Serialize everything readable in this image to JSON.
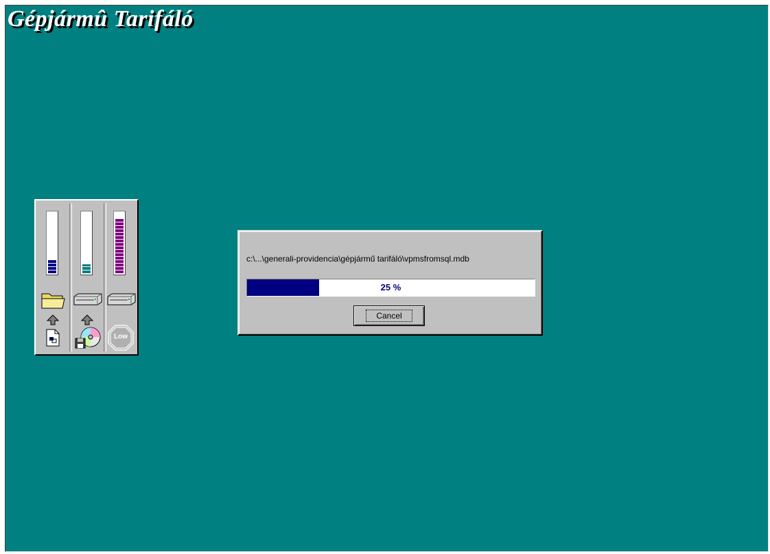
{
  "app": {
    "title": "Gépjármû Tarifáló"
  },
  "monitor": {
    "meters": [
      {
        "name": "disk-space-meter",
        "level": 0.22,
        "color": "#000080"
      },
      {
        "name": "source-space-meter",
        "level": 0.15,
        "color": "#008080"
      },
      {
        "name": "memory-meter",
        "level": 0.9,
        "color": "#800080"
      }
    ],
    "low_label": "Low",
    "icons": [
      "folder-icon",
      "hard-drive-icon",
      "hard-drive-icon",
      "arrow-up-icon",
      "arrow-up-icon",
      "document-icon",
      "cd-disk-icon",
      "low-stop-icon"
    ]
  },
  "dialog": {
    "file_path": "c:\\...\\generali-providencia\\gépjármű tarifáló\\vpmsfromsql.mdb",
    "progress_percent": 25,
    "progress_text": "25 %",
    "cancel_label": "Cancel"
  },
  "colors": {
    "desktop": "#008080",
    "progress_fill": "#000080",
    "dialog_face": "#c0c0c0"
  }
}
